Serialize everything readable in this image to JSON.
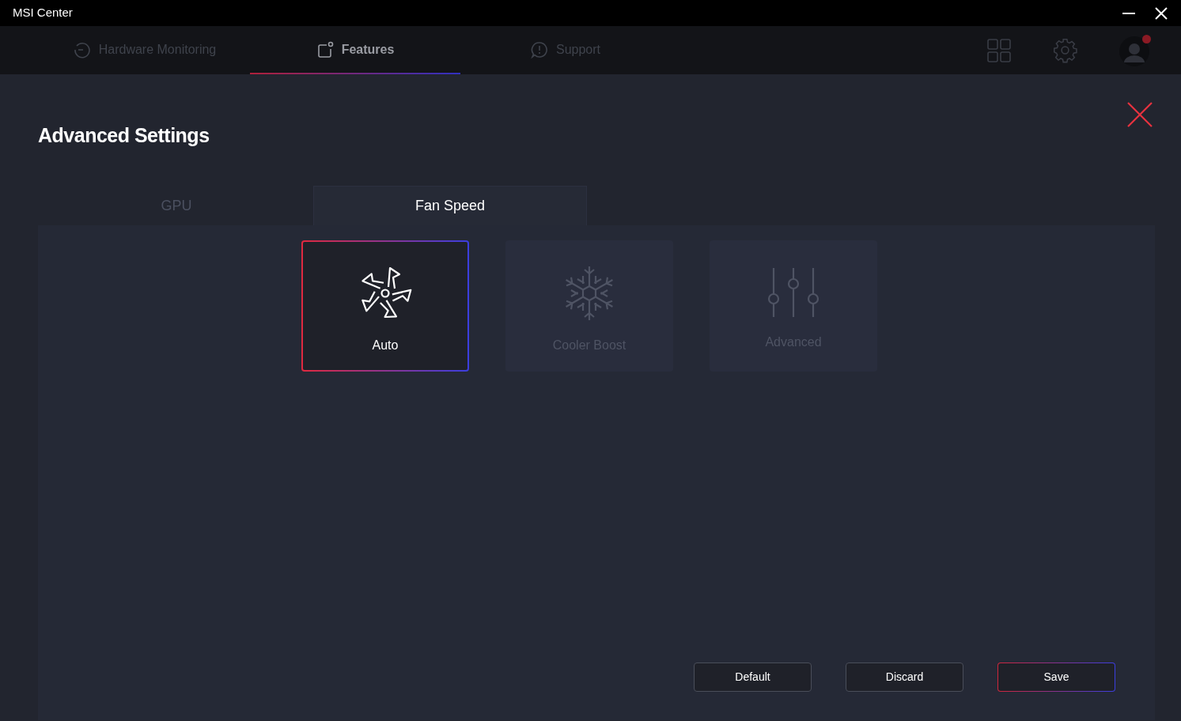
{
  "window": {
    "title": "MSI Center"
  },
  "nav_tabs": [
    {
      "label": "Hardware Monitoring",
      "kind": "monitor",
      "selected": false
    },
    {
      "label": "Features",
      "kind": "features",
      "selected": true
    },
    {
      "label": "Support",
      "kind": "support",
      "selected": false
    }
  ],
  "profile": {
    "notification": true
  },
  "page": {
    "title": "Advanced Settings"
  },
  "sub_tabs": [
    {
      "label": "GPU",
      "selected": false
    },
    {
      "label": "Fan Speed",
      "selected": true
    }
  ],
  "modes": [
    {
      "label": "Auto",
      "kind": "fan",
      "selected": true
    },
    {
      "label": "Cooler Boost",
      "kind": "snowflake",
      "selected": false
    },
    {
      "label": "Advanced",
      "kind": "sliders",
      "selected": false
    }
  ],
  "buttons": [
    {
      "label": "Default",
      "kind": "secondary"
    },
    {
      "label": "Discard",
      "kind": "secondary"
    },
    {
      "label": "Save",
      "kind": "primary"
    }
  ]
}
